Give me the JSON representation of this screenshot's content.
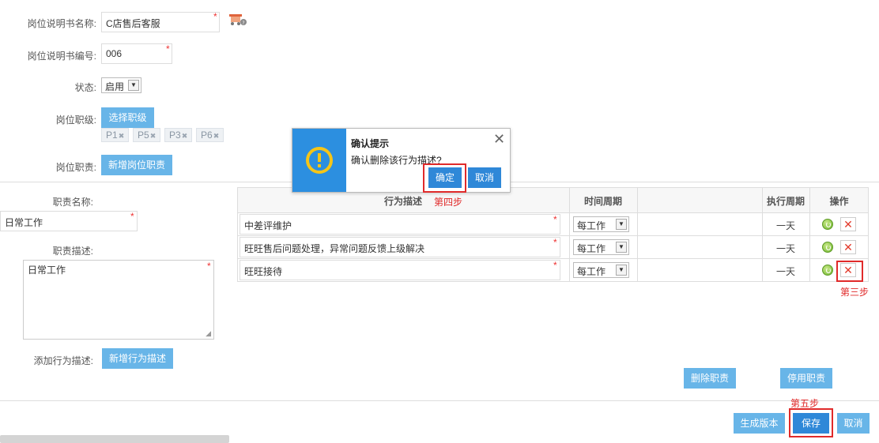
{
  "form": {
    "name_label": "岗位说明书名称:",
    "name_value": "C店售后客服",
    "code_label": "岗位说明书编号:",
    "code_value": "006",
    "status_label": "状态:",
    "status_value": "启用",
    "level_label": "岗位职级:",
    "level_button": "选择职级",
    "levels": [
      "P1",
      "P5",
      "P3",
      "P6"
    ],
    "duty_label": "岗位职责:",
    "duty_button": "新增岗位职责"
  },
  "duty": {
    "name_label": "职责名称:",
    "name_value": "日常工作",
    "desc_label": "职责描述:",
    "desc_value": "日常工作",
    "add_behavior_label": "添加行为描述:",
    "add_behavior_button": "新增行为描述",
    "delete_button": "删除职责",
    "disable_button": "停用职责"
  },
  "table": {
    "headers": [
      "行为描述",
      "时间周期",
      "",
      "执行周期",
      "操作"
    ],
    "rows": [
      {
        "desc": "中差评维护",
        "period": "每工作",
        "exec": "一天"
      },
      {
        "desc": "旺旺售后问题处理，异常问题反馈上级解决",
        "period": "每工作",
        "exec": "一天"
      },
      {
        "desc": "旺旺接待",
        "period": "每工作",
        "exec": "一天"
      }
    ]
  },
  "dialog": {
    "title": "确认提示",
    "message": "确认删除该行为描述?",
    "confirm": "确定",
    "cancel": "取消"
  },
  "annotations": {
    "step3": "第三步",
    "step4": "第四步",
    "step5": "第五步"
  },
  "footer": {
    "generate": "生成版本",
    "save": "保存",
    "cancel": "取消"
  },
  "colors": {
    "button_blue": "#68b5e8",
    "button_dark": "#2f88d8",
    "highlight_red": "#e02a2a",
    "dialog_icon_bg": "#2c8fe0",
    "dialog_icon": "#f5c518"
  }
}
